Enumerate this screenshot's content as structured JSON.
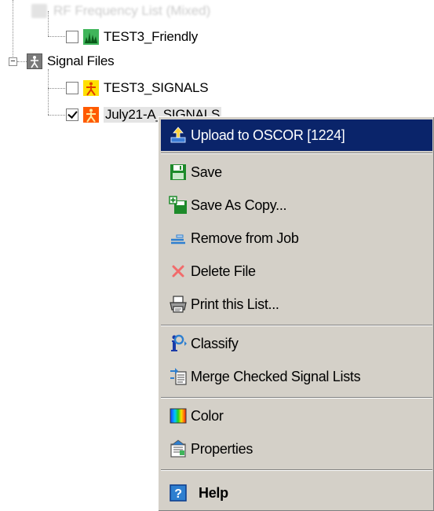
{
  "tree": {
    "faded_item": {
      "label": "RF Frequency List (Mixed)"
    },
    "rf_child": {
      "label": "TEST3_Friendly",
      "checked": false,
      "icon": "spectrum-icon"
    },
    "signal_folder": {
      "label": "Signal Files",
      "expander": "−",
      "icon": "signal-folder-icon"
    },
    "signal_items": [
      {
        "label": "TEST3_SIGNALS",
        "checked": false,
        "icon": "signal-person-yellow-icon",
        "color": "#ffd800"
      },
      {
        "label": "July21-A_SIGNALS",
        "checked": true,
        "icon": "signal-person-orange-icon",
        "color": "#ff5a00"
      }
    ]
  },
  "context_menu": {
    "highlight_color": "#0a246a",
    "items": [
      {
        "label": "Upload to OSCOR [1224]",
        "icon": "upload-icon"
      },
      {
        "label": "Save",
        "icon": "save-icon"
      },
      {
        "label": "Save As Copy...",
        "icon": "save-copy-icon"
      },
      {
        "label": "Remove from Job",
        "icon": "remove-icon"
      },
      {
        "label": "Delete File",
        "icon": "delete-x-icon"
      },
      {
        "label": "Print this List...",
        "icon": "printer-icon"
      },
      {
        "label": "Classify",
        "icon": "classify-icon"
      },
      {
        "label": "Merge Checked Signal Lists",
        "icon": "merge-icon"
      },
      {
        "label": "Color",
        "icon": "color-icon"
      },
      {
        "label": "Properties",
        "icon": "properties-icon"
      },
      {
        "label": "Help",
        "icon": "help-icon"
      }
    ]
  }
}
